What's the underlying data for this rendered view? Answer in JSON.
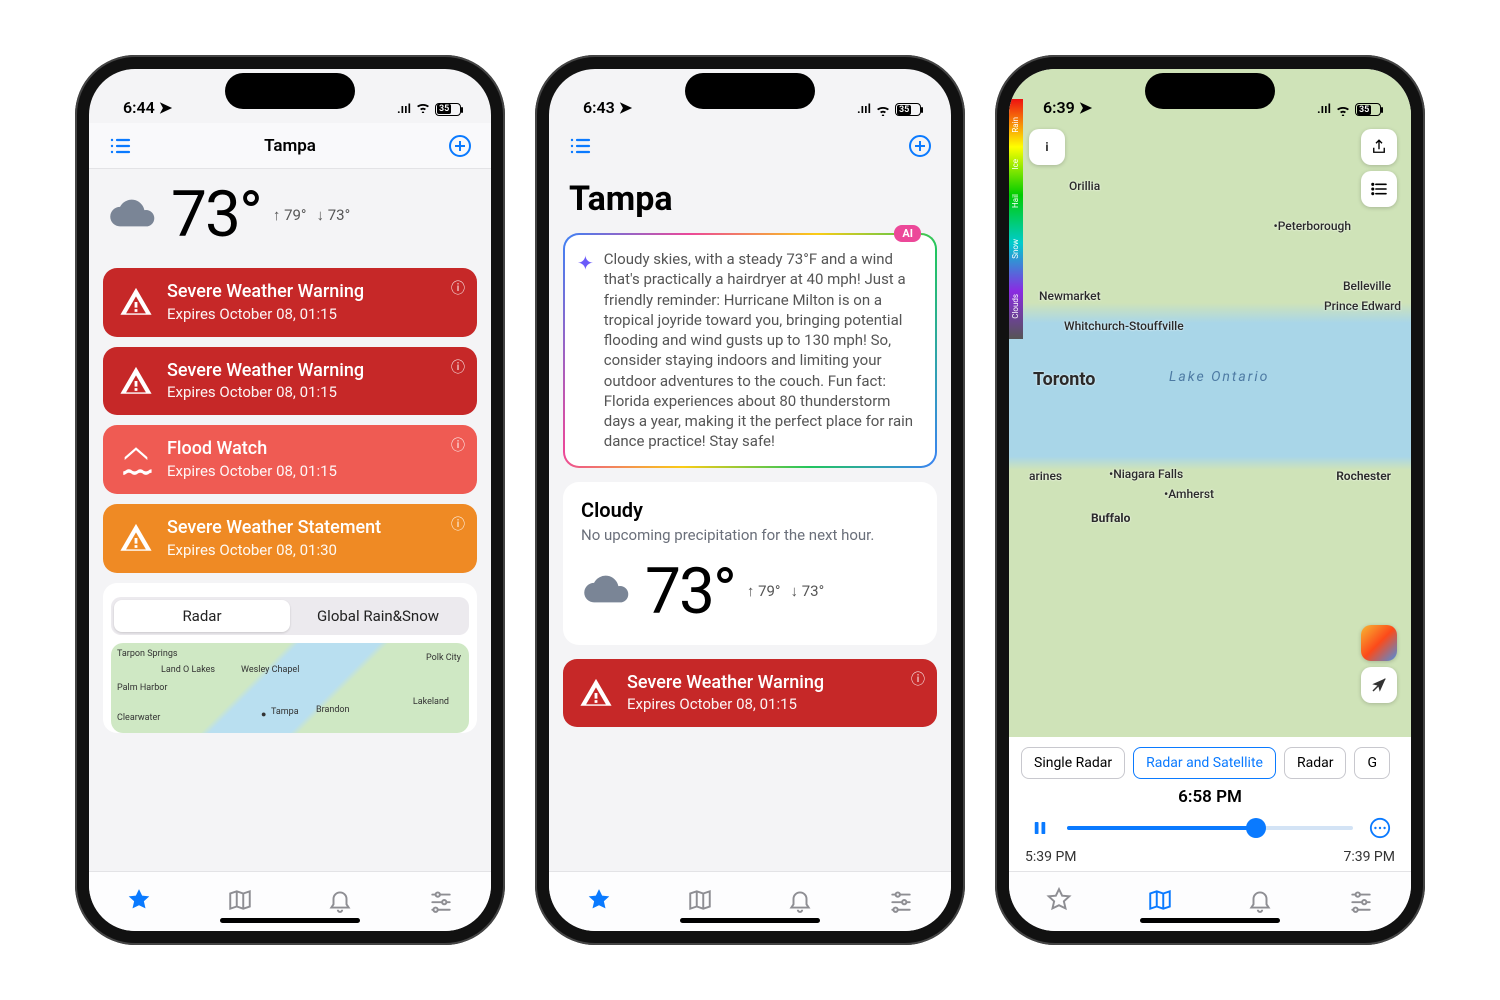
{
  "phone1": {
    "status_time": "6:44",
    "battery": "35",
    "nav_title": "Tampa",
    "temp": "73°",
    "hi": "↑ 79°",
    "lo": "↓ 73°",
    "alerts": [
      {
        "title": "Severe Weather Warning",
        "exp": "Expires October 08, 01:15",
        "cls": "red",
        "icon": "warning"
      },
      {
        "title": "Severe Weather Warning",
        "exp": "Expires October 08, 01:15",
        "cls": "red",
        "icon": "warning"
      },
      {
        "title": "Flood Watch",
        "exp": "Expires October 08, 01:15",
        "cls": "coral",
        "icon": "flood"
      },
      {
        "title": "Severe Weather Statement",
        "exp": "Expires October 08, 01:30",
        "cls": "orange",
        "icon": "warning"
      }
    ],
    "seg_a": "Radar",
    "seg_b": "Global Rain&Snow",
    "map_labels": [
      "Tarpon Springs",
      "Palm Harbor",
      "Clearwater",
      "Tampa",
      "Brandon",
      "Lakeland",
      "Land O Lakes",
      "Wesley Chapel",
      "Polk City"
    ]
  },
  "phone2": {
    "status_time": "6:43",
    "battery": "35",
    "title": "Tampa",
    "ai_badge": "AI",
    "ai_text": "Cloudy skies, with a steady 73°F and a wind that's practically a hairdryer at 40 mph! Just a friendly reminder: Hurricane Milton is on a tropical joyride toward you, bringing potential flooding and wind gusts up to 130 mph! So, consider staying indoors and limiting your outdoor adventures to the couch. Fun fact: Florida experiences about 80 thunderstorm days a year, making it the perfect place for rain dance practice! Stay safe!",
    "cond": "Cloudy",
    "precip": "No upcoming precipitation for the next hour.",
    "temp": "73°",
    "hi": "↑ 79°",
    "lo": "↓ 73°",
    "alert_title": "Severe Weather Warning",
    "alert_exp": "Expires October 08, 01:15"
  },
  "phone3": {
    "status_time": "6:39",
    "battery": "35",
    "legend": [
      "Rain",
      "Ice",
      "Hail",
      "Snow",
      "Clouds"
    ],
    "places": {
      "toronto": "Toronto",
      "orillia": "Orillia",
      "peterborough": "Peterborough",
      "belleville": "Belleville",
      "prince": "Prince Edward",
      "newmarket": "Newmarket",
      "whit": "Whitchurch-Stouffville",
      "lake": "Lake Ontario",
      "niagara": "Niagara Falls",
      "amherst": "Amherst",
      "buffalo": "Buffalo",
      "rochester": "Rochester",
      "irines": "arines"
    },
    "chips": [
      "Single Radar",
      "Radar and Satellite",
      "Radar",
      "G"
    ],
    "tl_now": "6:58 PM",
    "tl_start": "5:39 PM",
    "tl_end": "7:39 PM"
  }
}
